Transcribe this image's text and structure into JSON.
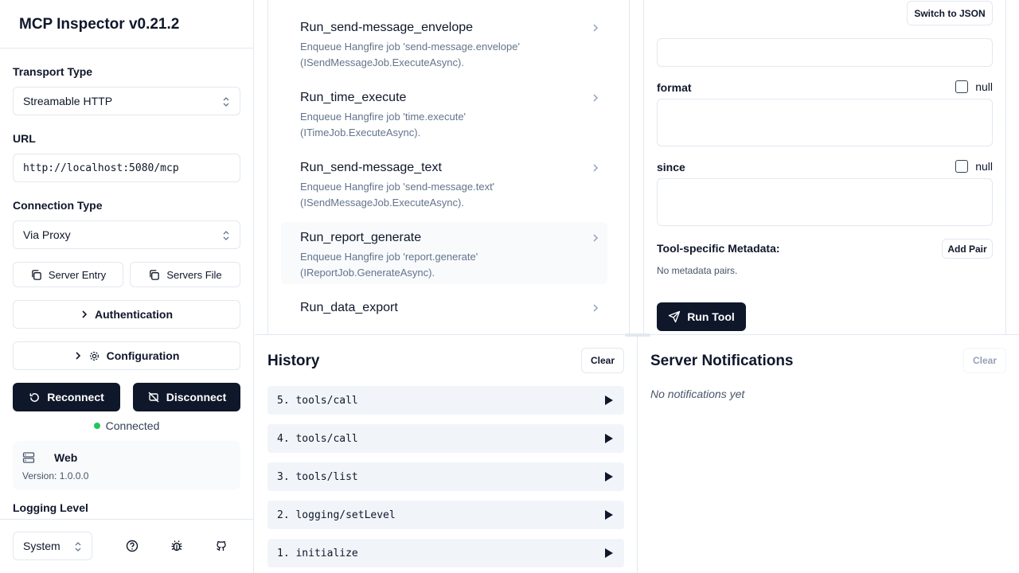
{
  "app": {
    "title": "MCP Inspector v0.21.2"
  },
  "sidebar": {
    "transport_label": "Transport Type",
    "transport_value": "Streamable HTTP",
    "url_label": "URL",
    "url_value": "http://localhost:5080/mcp",
    "connection_label": "Connection Type",
    "connection_value": "Via Proxy",
    "server_entry_label": "Server Entry",
    "servers_file_label": "Servers File",
    "authentication_label": "Authentication",
    "configuration_label": "Configuration",
    "reconnect_label": "Reconnect",
    "disconnect_label": "Disconnect",
    "status_text": "Connected",
    "status_color": "#22c55e",
    "server_name": "Web",
    "server_version": "Version: 1.0.0.0",
    "logging_label": "Logging Level",
    "theme_value": "System"
  },
  "tools": [
    {
      "name": "Run_send-message_envelope",
      "desc1": "Enqueue Hangfire job 'send-message.envelope'",
      "desc2": "(ISendMessageJob.ExecuteAsync)."
    },
    {
      "name": "Run_time_execute",
      "desc1": "Enqueue Hangfire job 'time.execute'",
      "desc2": "(ITimeJob.ExecuteAsync)."
    },
    {
      "name": "Run_send-message_text",
      "desc1": "Enqueue Hangfire job 'send-message.text'",
      "desc2": "(ISendMessageJob.ExecuteAsync)."
    },
    {
      "name": "Run_report_generate",
      "desc1": "Enqueue Hangfire job 'report.generate'",
      "desc2": "(IReportJob.GenerateAsync)."
    },
    {
      "name": "Run_data_export",
      "desc1": "",
      "desc2": ""
    }
  ],
  "form": {
    "switch_json_label": "Switch to JSON",
    "format_label": "format",
    "since_label": "since",
    "null_label": "null",
    "metadata_label": "Tool-specific Metadata:",
    "add_pair_label": "Add Pair",
    "no_metadata_text": "No metadata pairs.",
    "run_tool_label": "Run Tool"
  },
  "history": {
    "title": "History",
    "clear_label": "Clear",
    "items": [
      "5. tools/call",
      "4. tools/call",
      "3. tools/list",
      "2. logging/setLevel",
      "1. initialize"
    ]
  },
  "notifications": {
    "title": "Server Notifications",
    "clear_label": "Clear",
    "empty_text": "No notifications yet"
  }
}
